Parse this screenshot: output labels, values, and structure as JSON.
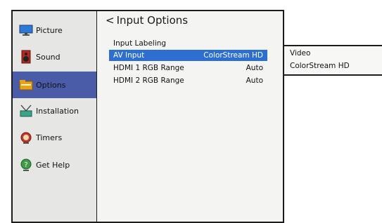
{
  "sidebar": {
    "items": [
      {
        "label": "Picture",
        "icon": "monitor-icon"
      },
      {
        "label": "Sound",
        "icon": "speaker-icon"
      },
      {
        "label": "Options",
        "icon": "folder-icon"
      },
      {
        "label": "Installation",
        "icon": "antenna-icon"
      },
      {
        "label": "Timers",
        "icon": "alarm-clock-icon"
      },
      {
        "label": "Get Help",
        "icon": "help-globe-icon"
      }
    ],
    "selected": "Options"
  },
  "main": {
    "back_glyph": "<",
    "title": "Input Options",
    "rows": [
      {
        "label": "Input Labeling",
        "value": ""
      },
      {
        "label": "AV Input",
        "value": "ColorStream HD"
      },
      {
        "label": "HDMI 1 RGB Range",
        "value": "Auto"
      },
      {
        "label": "HDMI 2 RGB Range",
        "value": "Auto"
      }
    ]
  },
  "popup": {
    "options": [
      "Video",
      "ColorStream HD"
    ]
  },
  "colors": {
    "selection_blue": "#2c6fd0",
    "sidebar_selected": "#4a5ba8",
    "frame": "#1c1c1c"
  }
}
